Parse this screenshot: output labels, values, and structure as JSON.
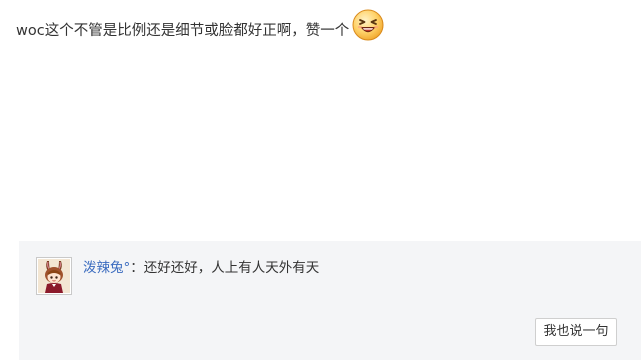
{
  "post": {
    "text": "woc这个不管是比例还是细节或脸都好正啊，赞一个",
    "emoticon": "grinning-squint-emoticon"
  },
  "reply_panel": {
    "replies": [
      {
        "username": "泼辣兔°",
        "separator": "：",
        "text": "还好还好，人上有人天外有天",
        "avatar": "anime-character-avatar"
      }
    ],
    "reply_button_label": "我也说一句"
  },
  "colors": {
    "username_link": "#3a6bbf",
    "panel_background": "#f4f5f7",
    "text": "#333333"
  }
}
